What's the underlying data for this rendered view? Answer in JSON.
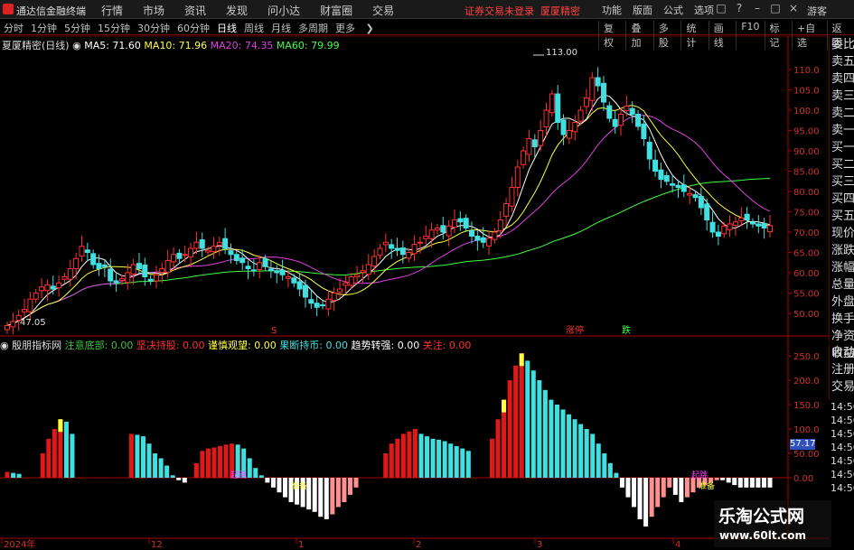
{
  "titlebar": {
    "app_name": "通达信金融终端",
    "menu": [
      "行情",
      "市场",
      "资讯",
      "发现",
      "问小达",
      "财富圈",
      "交易"
    ],
    "notice": "证券交易未登录",
    "stock_name_tag": "厦厦精密",
    "right_menu": [
      "功能",
      "版面",
      "公式",
      "选项"
    ],
    "guest": "游客"
  },
  "timeframes": [
    "分时",
    "1分钟",
    "5分钟",
    "15分钟",
    "30分钟",
    "60分钟",
    "日线",
    "周线",
    "月线",
    "多周期",
    "更多"
  ],
  "selected_timeframe": "日线",
  "tools": [
    "复权",
    "叠加",
    "多股",
    "统计",
    "画线",
    "F10",
    "标记",
    "+自选",
    "返回"
  ],
  "main_legend": {
    "name": "夏厦精密(日线)",
    "ma5": "MA5: 71.60",
    "ma10": "MA10: 71.96",
    "ma20": "MA20: 74.35",
    "ma60": "MA60: 79.99"
  },
  "indicator_legend": {
    "name": "殷朋指标网",
    "items": [
      {
        "label": "注意底部:",
        "value": "0.00",
        "color": "#40c040"
      },
      {
        "label": "坚决持股:",
        "value": "0.00",
        "color": "#ff3030"
      },
      {
        "label": "谨慎观望:",
        "value": "0.00",
        "color": "#ffff40"
      },
      {
        "label": "果断持币:",
        "value": "0.00",
        "color": "#40e0e0"
      },
      {
        "label": "趋势转强:",
        "value": "0.00",
        "color": "#ffffff"
      },
      {
        "label": "关注:",
        "value": "0.00",
        "color": "#ff3030"
      }
    ]
  },
  "price_axis": [
    "110.0",
    "105.0",
    "100.0",
    "95.00",
    "90.00",
    "85.00",
    "80.00",
    "75.00",
    "70.00",
    "65.00",
    "60.00",
    "55.00",
    "50.00"
  ],
  "indicator_axis": [
    "250.0",
    "200.0",
    "150.0",
    "100.0",
    "50.00",
    "0.00"
  ],
  "high_label": "113.00",
  "low_label": "47.05",
  "chart_markers": [
    {
      "text": "S",
      "color": "#ff3030"
    },
    {
      "text": "涨停",
      "color": "#ff3030"
    },
    {
      "text": "跌",
      "color": "#40ff40"
    }
  ],
  "indicator_markers": [
    "起跳",
    "起跳",
    "准备",
    "准备"
  ],
  "side_panel": [
    "委比",
    "卖五",
    "卖四",
    "卖三",
    "卖二",
    "卖一",
    "买一",
    "买二",
    "买三",
    "买四",
    "买五",
    "现价",
    "涨跌",
    "涨幅",
    "总量",
    "外盘",
    "换手",
    "净资",
    "收益"
  ],
  "side_panel2": [
    "自动",
    "注册",
    "交易"
  ],
  "times": [
    "14:56",
    "14:56",
    "14:56",
    "14:56",
    "14:56",
    "14:56",
    "14:56"
  ],
  "price_badge": "57.17",
  "date_axis": [
    "2024年",
    "12",
    "1",
    "2",
    "3",
    "4"
  ],
  "watermark": {
    "title": "乐淘公式网",
    "url": "www.60lt.com"
  },
  "chart_data": {
    "type": "candlestick",
    "title": "夏厦精密(日线)",
    "ylim": [
      46,
      116
    ],
    "close": [
      47.0,
      48.0,
      49.5,
      51.0,
      53.5,
      55.0,
      56.5,
      57.0,
      56.0,
      57.5,
      59.0,
      61.0,
      63.5,
      66.5,
      65.0,
      62.0,
      61.0,
      61.5,
      58.0,
      57.5,
      58.5,
      60.0,
      62.0,
      61.0,
      59.0,
      58.0,
      59.5,
      61.0,
      63.0,
      64.5,
      63.5,
      64.5,
      66.0,
      67.5,
      66.0,
      65.5,
      66.5,
      67.5,
      66.0,
      64.5,
      63.0,
      62.5,
      61.0,
      60.5,
      62.5,
      61.5,
      60.5,
      60.0,
      59.5,
      59.0,
      57.5,
      56.0,
      54.0,
      52.5,
      51.5,
      52.0,
      53.5,
      55.0,
      56.0,
      57.5,
      59.0,
      59.5,
      60.5,
      62.0,
      64.0,
      66.0,
      67.5,
      66.0,
      65.5,
      64.5,
      65.0,
      67.0,
      67.5,
      69.0,
      70.5,
      71.0,
      70.0,
      71.5,
      73.0,
      72.5,
      71.0,
      69.0,
      68.0,
      67.5,
      68.5,
      70.0,
      73.0,
      77.0,
      81.0,
      86.0,
      90.0,
      93.0,
      91.0,
      95.0,
      100.0,
      104.0,
      97.0,
      94.0,
      95.0,
      97.0,
      100.0,
      103.0,
      108.0,
      106.0,
      102.0,
      98.0,
      96.0,
      99.0,
      101.0,
      99.0,
      96.0,
      93.0,
      88.0,
      85.0,
      83.0,
      82.5,
      81.5,
      81.0,
      80.0,
      79.5,
      78.5,
      76.0,
      73.0,
      70.0,
      69.0,
      71.5,
      72.0,
      72.5,
      73.5,
      73.0,
      72.0,
      71.5,
      71.0,
      71.6
    ],
    "ma_values": {
      "MA5": 71.6,
      "MA10": 71.96,
      "MA20": 74.35,
      "MA60": 79.99
    },
    "indicator": {
      "type": "bar",
      "values": [
        12,
        10,
        8,
        0,
        0,
        0,
        50,
        80,
        100,
        120,
        115,
        90,
        0,
        0,
        0,
        0,
        0,
        0,
        0,
        0,
        0,
        90,
        88,
        85,
        70,
        50,
        40,
        25,
        5,
        -5,
        -10,
        0,
        30,
        55,
        60,
        62,
        65,
        68,
        70,
        68,
        60,
        40,
        20,
        5,
        -10,
        -20,
        -30,
        -40,
        -50,
        -55,
        -60,
        -65,
        -70,
        -80,
        -85,
        -75,
        -60,
        -50,
        -35,
        -20,
        0,
        0,
        0,
        0,
        50,
        70,
        80,
        90,
        95,
        100,
        90,
        85,
        80,
        78,
        75,
        70,
        65,
        60,
        55,
        0,
        0,
        0,
        80,
        120,
        160,
        200,
        230,
        255,
        240,
        220,
        200,
        180,
        160,
        150,
        140,
        130,
        120,
        110,
        100,
        90,
        70,
        50,
        30,
        10,
        -20,
        -40,
        -60,
        -85,
        -100,
        -80,
        -60,
        -40,
        -20,
        -35,
        -50,
        -40,
        -30,
        -20,
        -15,
        -10,
        -5,
        -5,
        -10,
        -15,
        -20,
        -20,
        -20,
        -20,
        -20,
        -20
      ]
    }
  }
}
